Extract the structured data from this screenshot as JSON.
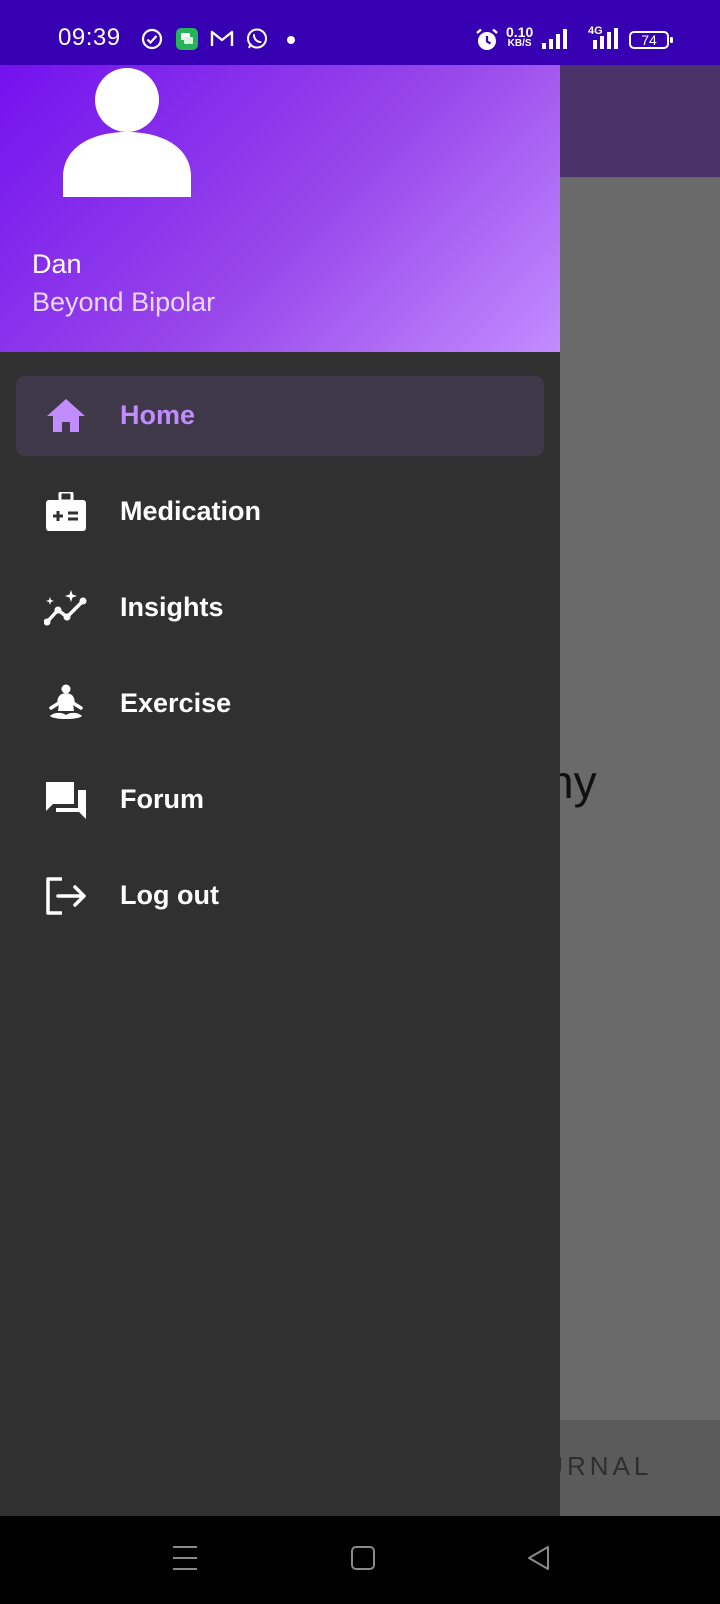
{
  "status_bar": {
    "time": "09:39",
    "net_speed_value": "0.10",
    "net_speed_unit": "KB/S",
    "network_type": "4G",
    "battery": "74",
    "icons": [
      "check-circle-icon",
      "chat-app-icon",
      "gmail-icon",
      "whatsapp-icon",
      "notification-dot-icon",
      "alarm-icon",
      "signal-icon",
      "signal-4g-icon",
      "battery-icon"
    ]
  },
  "background_app": {
    "partial_text": "ny",
    "bottom_button_partial": "OURNAL"
  },
  "drawer": {
    "header": {
      "user_name": "Dan",
      "organization": "Beyond Bipolar"
    },
    "items": [
      {
        "label": "Home",
        "icon": "home-icon",
        "active": true
      },
      {
        "label": "Medication",
        "icon": "medical-kit-icon",
        "active": false
      },
      {
        "label": "Insights",
        "icon": "insights-icon",
        "active": false
      },
      {
        "label": "Exercise",
        "icon": "meditation-icon",
        "active": false
      },
      {
        "label": "Forum",
        "icon": "forum-icon",
        "active": false
      },
      {
        "label": "Log out",
        "icon": "logout-icon",
        "active": false
      }
    ]
  },
  "colors": {
    "status_bar": "#3700b3",
    "accent": "#c08cff",
    "drawer_bg": "#303030"
  }
}
